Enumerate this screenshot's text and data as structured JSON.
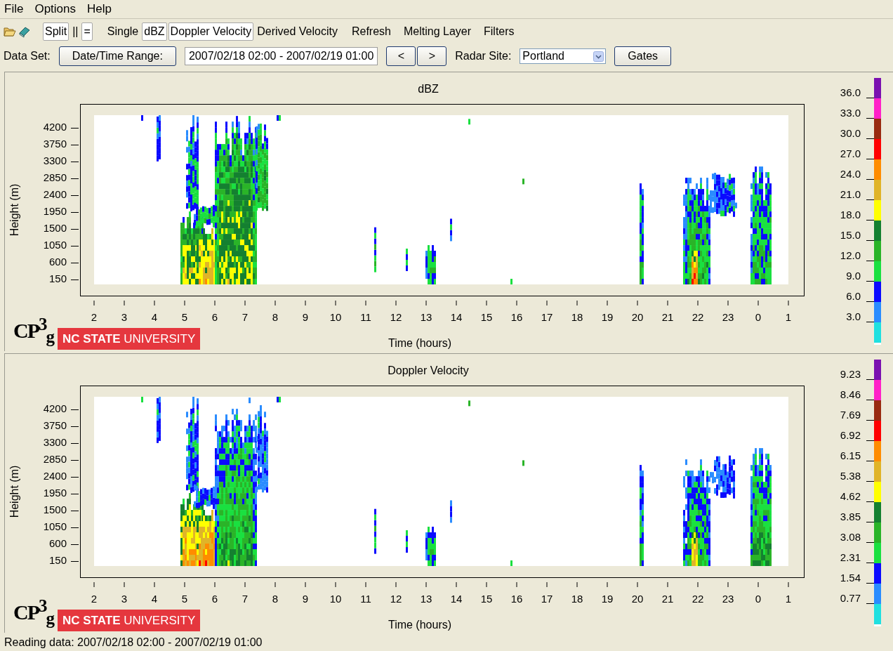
{
  "menu": [
    {
      "label": "File"
    },
    {
      "label": "Options"
    },
    {
      "label": "Help"
    }
  ],
  "toolbar": {
    "layout_toggles": [
      {
        "label": "Split",
        "selected": true
      },
      {
        "label": "||",
        "selected": false
      },
      {
        "label": "=",
        "selected": true
      }
    ],
    "field_toggles": [
      {
        "label": "Single",
        "selected": false
      },
      {
        "label": "dBZ",
        "selected": true
      },
      {
        "label": "Doppler Velocity",
        "selected": true
      },
      {
        "label": "Derived Velocity",
        "selected": false
      }
    ],
    "actions": [
      "Refresh",
      "Melting Layer",
      "Filters"
    ]
  },
  "data_set": {
    "label": "Data Set:",
    "range_button": "Date/Time Range:",
    "range_value": "2007/02/18 02:00 - 2007/02/19 01:00",
    "prev_button": "<",
    "next_button": ">",
    "site_label": "Radar Site:",
    "site": "Portland",
    "gates_button": "Gates"
  },
  "panels": [
    {
      "kind": "reflectivity",
      "title": "dBZ",
      "ylabel": "Height (m)",
      "xlabel": "Time (hours)",
      "yticks": [
        "4200",
        "3750",
        "3300",
        "2850",
        "2400",
        "1950",
        "1500",
        "1050",
        "600",
        "150"
      ],
      "xticks": [
        "2",
        "3",
        "4",
        "5",
        "6",
        "7",
        "8",
        "9",
        "10",
        "11",
        "12",
        "13",
        "14",
        "15",
        "16",
        "17",
        "18",
        "19",
        "20",
        "21",
        "22",
        "23",
        "0",
        "1"
      ],
      "scale_labels": [
        "36.0",
        "33.0",
        "30.0",
        "27.0",
        "24.0",
        "21.0",
        "18.0",
        "15.0",
        "12.0",
        "9.0",
        "6.0",
        "3.0"
      ],
      "scale_colors": [
        {
          "color": "#7a10b0"
        },
        {
          "color": "#ff20c8"
        },
        {
          "color": "#992a10"
        },
        {
          "color": "#ff0000"
        },
        {
          "color": "#ff8c00"
        },
        {
          "color": "#e0b428"
        },
        {
          "color": "#ffff00"
        },
        {
          "color": "#148030"
        },
        {
          "color": "#2ab428"
        },
        {
          "color": "#1ae040"
        },
        {
          "color": "#0a0aff"
        },
        {
          "color": "#2a8cff"
        },
        {
          "color": "#20e0e0"
        }
      ],
      "logo": "CP$^{3}$$_{g}$",
      "badge": "**NC STATE** UNIVERSITY"
    },
    {
      "kind": "velocity",
      "title": "Doppler Velocity",
      "ylabel": "Height (m)",
      "xlabel": "Time (hours)",
      "yticks": [
        "4200",
        "3750",
        "3300",
        "2850",
        "2400",
        "1950",
        "1500",
        "1050",
        "600",
        "150"
      ],
      "xticks": [
        "2",
        "3",
        "4",
        "5",
        "6",
        "7",
        "8",
        "9",
        "10",
        "11",
        "12",
        "13",
        "14",
        "15",
        "16",
        "17",
        "18",
        "19",
        "20",
        "21",
        "22",
        "23",
        "0",
        "1"
      ],
      "scale_labels": [
        "9.23",
        "8.46",
        "7.69",
        "6.92",
        "6.15",
        "5.38",
        "4.62",
        "3.85",
        "3.08",
        "2.31",
        "1.54",
        "0.77"
      ],
      "scale_colors": [
        {
          "color": "#7a10b0"
        },
        {
          "color": "#ff20c8"
        },
        {
          "color": "#992a10"
        },
        {
          "color": "#ff0000"
        },
        {
          "color": "#ff8c00"
        },
        {
          "color": "#e0b428"
        },
        {
          "color": "#ffff00"
        },
        {
          "color": "#148030"
        },
        {
          "color": "#2ab428"
        },
        {
          "color": "#1ae040"
        },
        {
          "color": "#0a0aff"
        },
        {
          "color": "#2a8cff"
        },
        {
          "color": "#20e0e0"
        }
      ],
      "logo": "CP$^{3}$$_{g}$",
      "badge": "**NC STATE** UNIVERSITY"
    }
  ],
  "status_bar": "Reading data: 2007/02/18 02:00 - 2007/02/19 01:00"
}
